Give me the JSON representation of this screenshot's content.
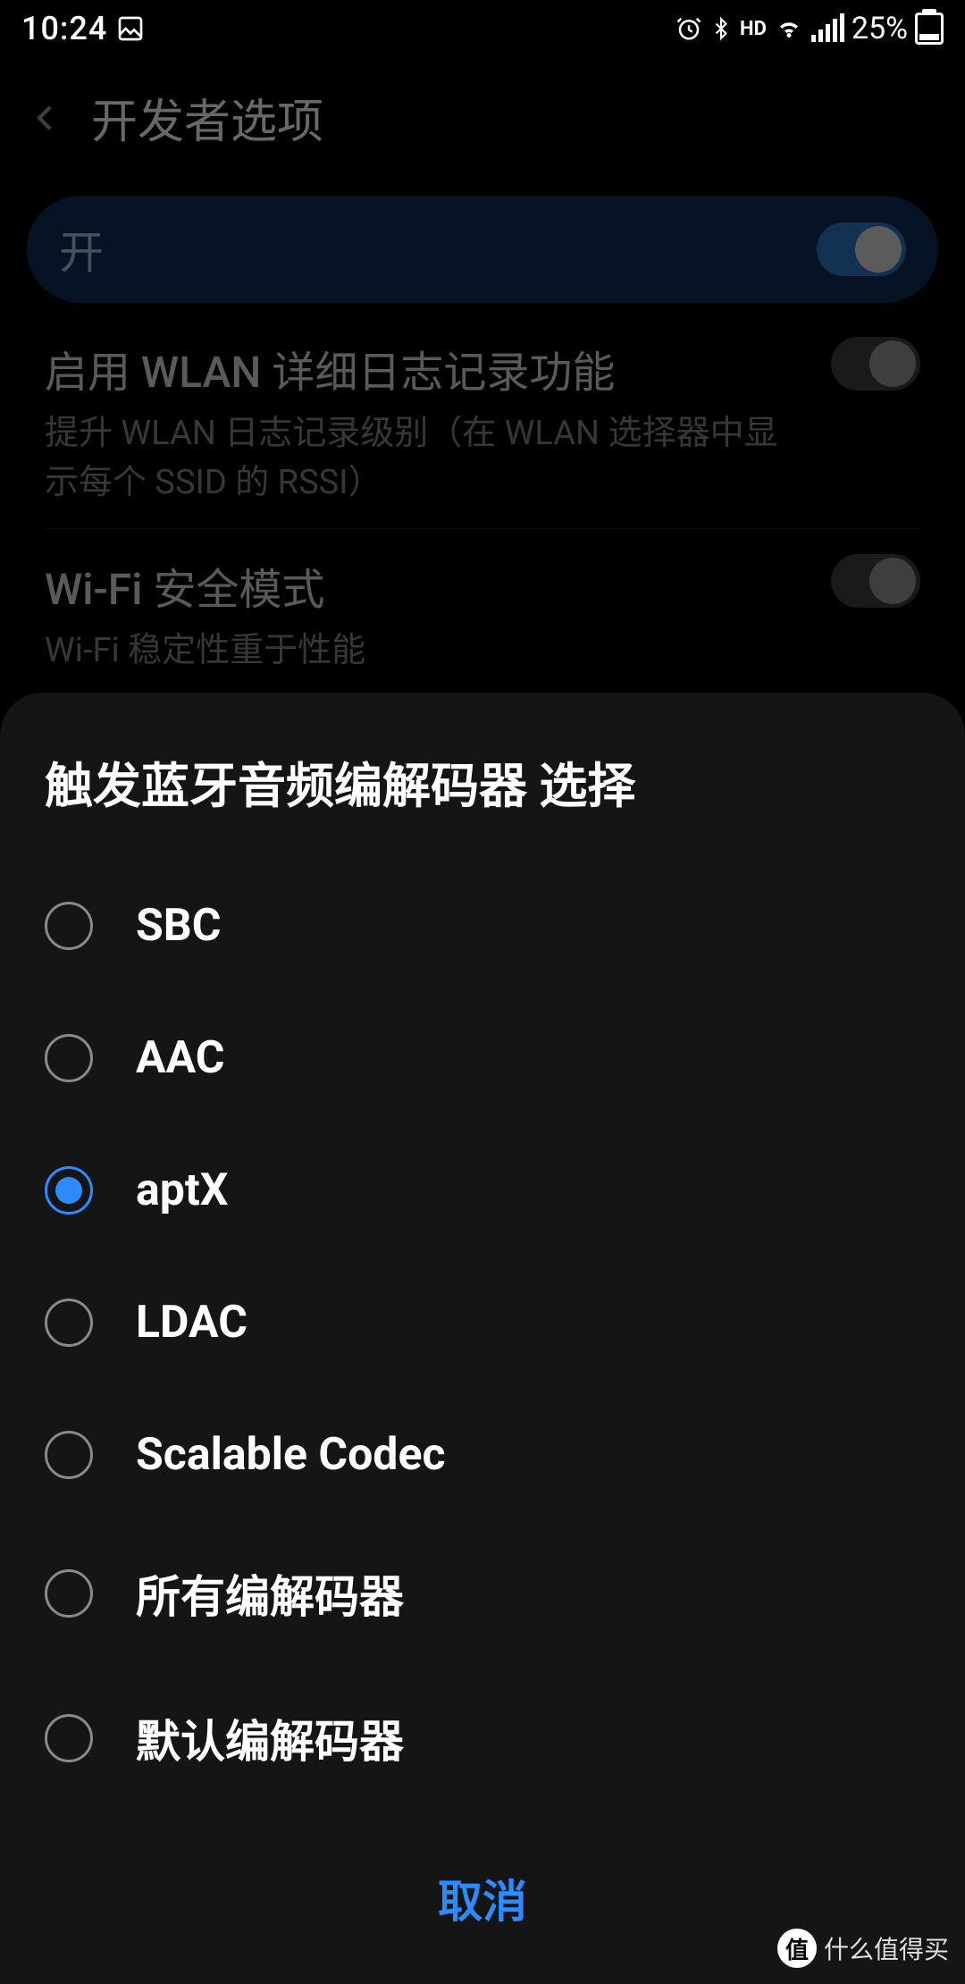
{
  "status": {
    "clock": "10:24",
    "battery_pct": "25%",
    "hd_label": "HD",
    "icons": {
      "picture": "picture-icon",
      "alarm": "alarm-icon",
      "bluetooth": "bluetooth-icon",
      "wifi": "wifi-icon",
      "signal": "signal-icon",
      "battery": "battery-icon"
    }
  },
  "page": {
    "title": "开发者选项",
    "master_toggle": {
      "label": "开",
      "on": true
    },
    "rows": [
      {
        "title": "启用 WLAN 详细日志记录功能",
        "sub": "提升 WLAN 日志记录级别（在 WLAN 选择器中显示每个 SSID 的 RSSI）",
        "on": false
      },
      {
        "title": "Wi-Fi 安全模式",
        "sub": "Wi-Fi 稳定性重于性能",
        "on": false
      }
    ]
  },
  "dialog": {
    "title": "触发蓝牙音频编解码器 选择",
    "options": [
      {
        "label": "SBC",
        "selected": false
      },
      {
        "label": "AAC",
        "selected": false
      },
      {
        "label": "aptX",
        "selected": true
      },
      {
        "label": "LDAC",
        "selected": false
      },
      {
        "label": "Scalable Codec",
        "selected": false
      },
      {
        "label": "所有编解码器",
        "selected": false
      },
      {
        "label": "默认编解码器",
        "selected": false
      }
    ],
    "cancel": "取消"
  },
  "watermark": {
    "badge": "值",
    "text": "什么值得买"
  },
  "colors": {
    "accent": "#2e8bff",
    "master_bg": "#0f2c52",
    "dialog_bg": "#151515"
  }
}
